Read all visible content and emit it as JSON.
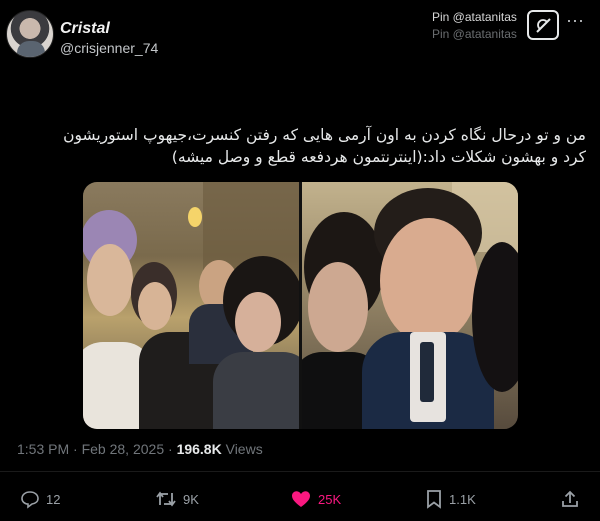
{
  "author": {
    "display_name": "Cristal",
    "handle": "@crisjenner_74"
  },
  "pin": {
    "label": "Pin @atatanitas",
    "label_faded": "Pin @atatanitas"
  },
  "icons": {
    "grok": "grok-icon",
    "more": "more-icon",
    "reply": "reply-icon",
    "retweet": "retweet-icon",
    "like": "heart-icon",
    "bookmark": "bookmark-icon",
    "share": "share-icon"
  },
  "tweet": {
    "text": "من و تو درحال نگاه کردن به اون آرمی هایی که رفتن کنسرت،جیهوپ استوریشون کرد و بهشون شکلات داد:(اینترنتمون هردفعه قطع و وصل میشه)"
  },
  "meta": {
    "time": "1:53 PM",
    "separator": "·",
    "date": "Feb 28, 2025",
    "separator2": "·",
    "views_count": "196.8K",
    "views_label": "Views"
  },
  "actions": {
    "reply_count": "12",
    "retweet_count": "9K",
    "like_count": "25K",
    "bookmark_count": "1.1K"
  },
  "colors": {
    "background": "#000000",
    "like_active": "#f91880",
    "muted": "#71767b"
  }
}
